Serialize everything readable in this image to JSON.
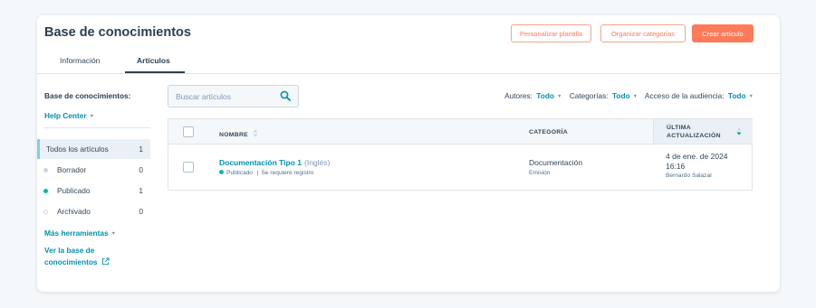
{
  "header": {
    "title": "Base de conocimientos",
    "buttons": {
      "customize_template": "Personalizar plantilla",
      "organize_categories": "Organizar categorías",
      "create_article": "Crear artículo"
    }
  },
  "tabs": [
    {
      "label": "Información",
      "active": false
    },
    {
      "label": "Artículos",
      "active": true
    }
  ],
  "sidebar": {
    "title": "Base de conocimientos:",
    "selector": "Help Center",
    "items": [
      {
        "label": "Todos los artículos",
        "count": "1",
        "active": true
      },
      {
        "label": "Borrador",
        "count": "0",
        "status_color": "#cbd6e2"
      },
      {
        "label": "Publicado",
        "count": "1",
        "status_color": "#00bda5"
      },
      {
        "label": "Archivado",
        "count": "0",
        "status_color": "#ffffff"
      }
    ],
    "more_tools": "Más herramientas",
    "view_kb": "Ver la base de conocimientos"
  },
  "search": {
    "placeholder": "Buscar artículos",
    "icon": "search-icon"
  },
  "filters": {
    "authors_label": "Autores:",
    "authors_value": "Todo",
    "categories_label": "Categorías:",
    "categories_value": "Todo",
    "audience_label": "Acceso de la audiencia:",
    "audience_value": "Todo"
  },
  "table": {
    "columns": {
      "name": "NOMBRE",
      "category": "CATEGORÍA",
      "updated_line1": "ÚLTIMA",
      "updated_line2": "ACTUALIZACIÓN"
    },
    "rows": [
      {
        "title": "Documentación Tipo 1",
        "language": "(Inglés)",
        "status": "Publicado",
        "access": "Se requiere registro",
        "status_color": "#00bda5",
        "category": "Documentación",
        "subcategory": "Emisión",
        "updated_date": "4 de ene. de 2024",
        "updated_time": "16:16",
        "updated_by": "Bernardo Salazar"
      }
    ]
  },
  "colors": {
    "accent": "#ff7a59",
    "link": "#0091ae",
    "published": "#00bda5"
  }
}
